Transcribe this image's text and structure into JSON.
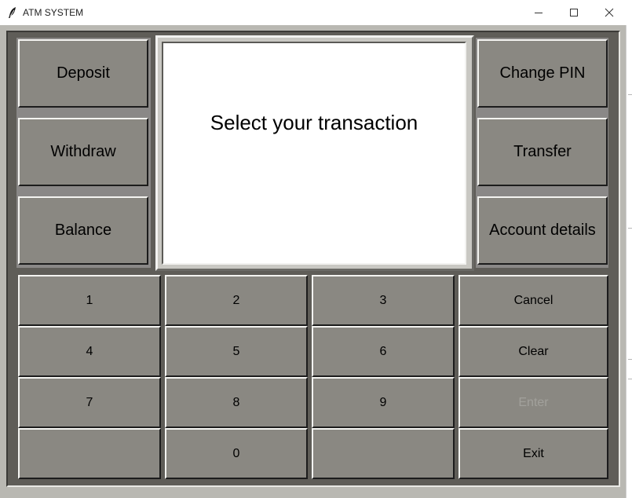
{
  "window": {
    "title": "ATM SYSTEM",
    "icons": [
      "feather-icon",
      "minimize-icon",
      "maximize-icon",
      "close-icon"
    ]
  },
  "left_buttons": [
    "Deposit",
    "Withdraw",
    "Balance"
  ],
  "right_buttons": [
    "Change PIN",
    "Transfer",
    "Account details"
  ],
  "screen": {
    "message": "Select your transaction"
  },
  "keypad": {
    "rows": [
      [
        "1",
        "2",
        "3",
        "Cancel"
      ],
      [
        "4",
        "5",
        "6",
        "Clear"
      ],
      [
        "7",
        "8",
        "9",
        "Enter"
      ],
      [
        "",
        "0",
        "",
        "Exit"
      ]
    ],
    "disabled": [
      "Enter"
    ]
  },
  "colors": {
    "button_face": "#8a8882",
    "panel_dark": "#5f5d58",
    "screen_bg": "#ffffff",
    "disabled_text": "#a2a19c"
  }
}
